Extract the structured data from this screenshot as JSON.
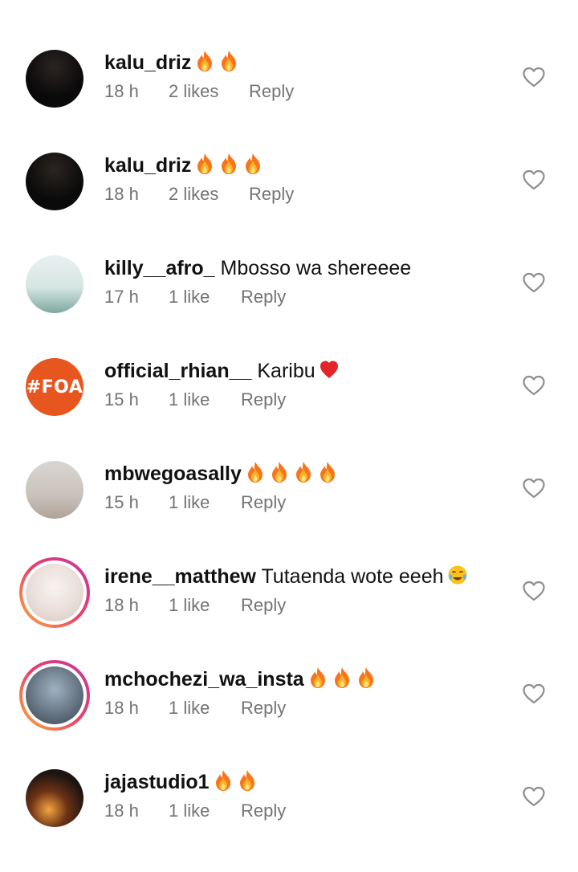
{
  "comments": [
    {
      "username": "kalu_driz",
      "text": "",
      "time": "18 h",
      "likes": "2 likes",
      "reply": "Reply",
      "emojis": [
        "fire-emoji",
        "fire-emoji"
      ],
      "avatar": "dark-portrait",
      "ring": false
    },
    {
      "username": "kalu_driz",
      "text": "",
      "time": "18 h",
      "likes": "2 likes",
      "reply": "Reply",
      "emojis": [
        "fire-emoji",
        "fire-emoji",
        "fire-emoji"
      ],
      "avatar": "dark-portrait",
      "ring": false
    },
    {
      "username": "killy__afro_",
      "text": "Mbosso wa shereeee",
      "time": "17 h",
      "likes": "1 like",
      "reply": "Reply",
      "emojis": [],
      "avatar": "hat-portrait",
      "ring": false
    },
    {
      "username": "official_rhian__",
      "text": "Karibu",
      "time": "15 h",
      "likes": "1 like",
      "reply": "Reply",
      "emojis": [
        "red-heart-emoji"
      ],
      "avatar": "foa-logo",
      "avatar_text": "#FOA",
      "ring": false
    },
    {
      "username": "mbwegoasally",
      "text": "",
      "time": "15 h",
      "likes": "1 like",
      "reply": "Reply",
      "emojis": [
        "fire-emoji",
        "fire-emoji",
        "fire-emoji",
        "fire-emoji"
      ],
      "avatar": "room-portrait",
      "ring": false
    },
    {
      "username": "irene__matthew",
      "text": "Tutaenda wote eeeh",
      "time": "18 h",
      "likes": "1 like",
      "reply": "Reply",
      "emojis": [
        "tears-of-joy-emoji"
      ],
      "avatar": "white-portrait",
      "ring": true
    },
    {
      "username": "mchochezi_wa_insta",
      "text": "",
      "time": "18 h",
      "likes": "1 like",
      "reply": "Reply",
      "emojis": [
        "fire-emoji",
        "fire-emoji",
        "fire-emoji"
      ],
      "avatar": "cartoon-portrait",
      "ring": true
    },
    {
      "username": "jajastudio1",
      "text": "",
      "time": "18 h",
      "likes": "1 like",
      "reply": "Reply",
      "emojis": [
        "fire-emoji",
        "fire-emoji"
      ],
      "avatar": "night-portrait",
      "ring": false
    }
  ],
  "colors": {
    "text": "#111111",
    "meta": "#737373",
    "heart_outline": "#8e8e8e",
    "story_ring": "#ec3f6a"
  }
}
